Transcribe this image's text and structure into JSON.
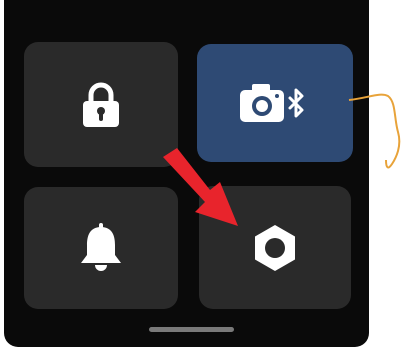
{
  "quick_settings": {
    "tiles": [
      {
        "id": "lock",
        "icon": "lock-icon",
        "active": false
      },
      {
        "id": "camera-bluetooth",
        "icon": "camera-bluetooth-icon",
        "active": true
      },
      {
        "id": "notifications",
        "icon": "bell-icon",
        "active": false
      },
      {
        "id": "settings",
        "icon": "hexagon-nut-icon",
        "active": false
      }
    ]
  },
  "annotations": {
    "arrow_color": "#e8242c",
    "squiggle_color": "#e8a33a"
  },
  "colors": {
    "screen_background": "#0a0a0a",
    "tile_background": "#2a2a2a",
    "active_tile_background": "#2e4a74",
    "icon_color": "#ffffff"
  }
}
